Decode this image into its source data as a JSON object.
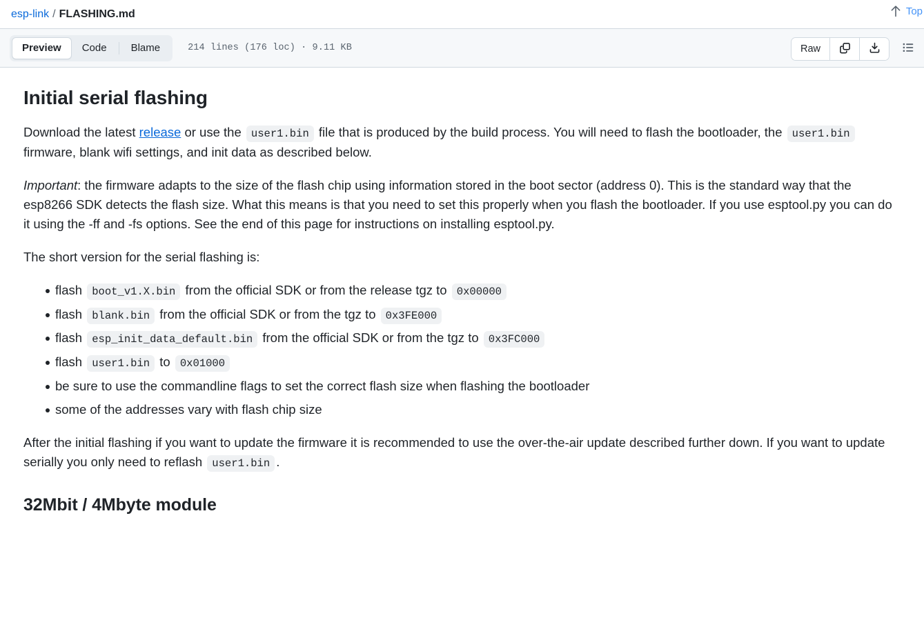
{
  "header": {
    "repo": "esp-link",
    "separator": "/",
    "file_name": "FLASHING.md",
    "top_label": "Top"
  },
  "toolbar": {
    "tabs": [
      {
        "label": "Preview",
        "active": true
      },
      {
        "label": "Code",
        "active": false
      },
      {
        "label": "Blame",
        "active": false
      }
    ],
    "file_meta": "214 lines (176 loc) · 9.11 KB",
    "raw_label": "Raw",
    "icons": {
      "copy": "copy-icon",
      "download": "download-icon",
      "outline": "outline-list-icon"
    }
  },
  "content": {
    "heading1": "Initial serial flashing",
    "p1": {
      "a": "Download the latest ",
      "link": "release",
      "b": " or use the ",
      "code1": "user1.bin",
      "c": " file that is produced by the build process. You will need to flash the bootloader, the ",
      "code2": "user1.bin",
      "d": " firmware, blank wifi settings, and init data as described below."
    },
    "p2": {
      "em": "Important",
      "rest": ": the firmware adapts to the size of the flash chip using information stored in the boot sector (address 0). This is the standard way that the esp8266 SDK detects the flash size. What this means is that you need to set this properly when you flash the bootloader. If you use esptool.py you can do it using the -ff and -fs options. See the end of this page for instructions on installing esptool.py."
    },
    "p3": "The short version for the serial flashing is:",
    "list": [
      {
        "a": "flash ",
        "code1": "boot_v1.X.bin",
        "b": " from the official SDK or from the release tgz to ",
        "code2": "0x00000",
        "c": ""
      },
      {
        "a": "flash ",
        "code1": "blank.bin",
        "b": " from the official SDK or from the tgz to ",
        "code2": "0x3FE000",
        "c": ""
      },
      {
        "a": "flash ",
        "code1": "esp_init_data_default.bin",
        "b": " from the official SDK or from the tgz to ",
        "code2": "0x3FC000",
        "c": ""
      },
      {
        "a": "flash ",
        "code1": "user1.bin",
        "b": " to ",
        "code2": "0x01000",
        "c": ""
      },
      {
        "a": "be sure to use the commandline flags to set the correct flash size when flashing the bootloader",
        "code1": "",
        "b": "",
        "code2": "",
        "c": ""
      },
      {
        "a": "some of the addresses vary with flash chip size",
        "code1": "",
        "b": "",
        "code2": "",
        "c": ""
      }
    ],
    "p4": {
      "a": "After the initial flashing if you want to update the firmware it is recommended to use the over-the-air update described further down. If you want to update serially you only need to reflash ",
      "code1": "user1.bin",
      "b": "."
    },
    "heading2": "32Mbit / 4Mbyte module"
  },
  "colors": {
    "link": "#0969da",
    "toolbar_bg": "#f6f8fa",
    "border": "#d1d9e0",
    "code_bg": "#eff1f3",
    "text": "#1f2328"
  }
}
